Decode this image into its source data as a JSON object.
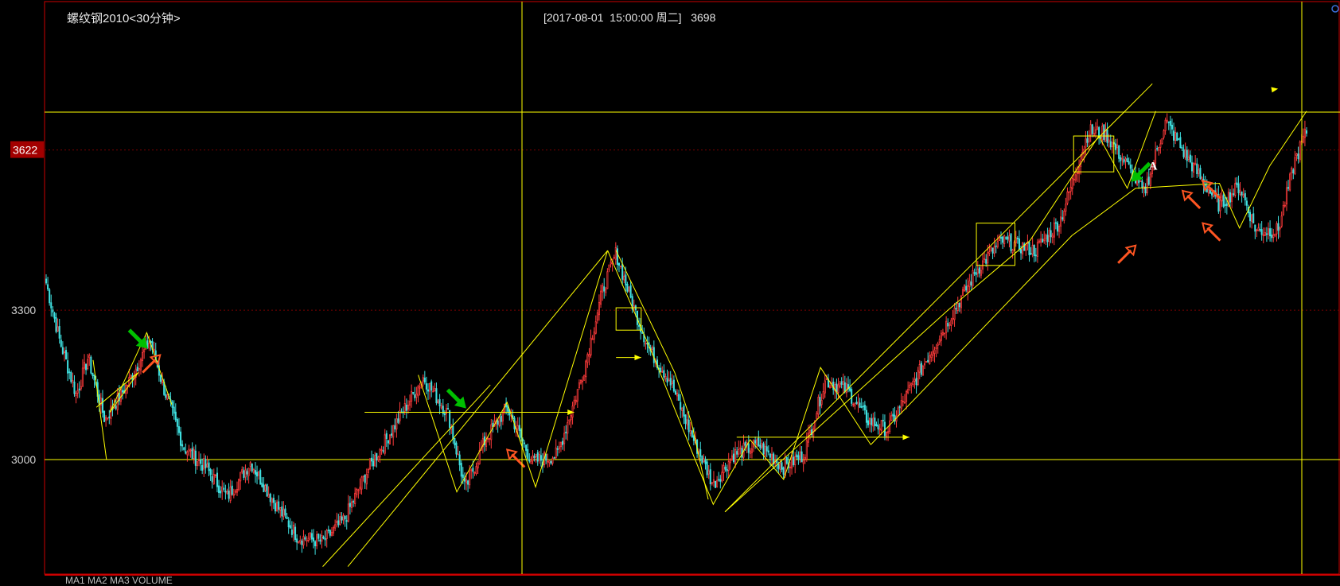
{
  "header": {
    "title": "螺纹钢2010<30分钟>",
    "cursor_time": "[2017-08-01  15:00:00 周二]",
    "cursor_value": "3698"
  },
  "price_axis": {
    "labels": [
      "3300",
      "3000"
    ],
    "highlight_label": "3622"
  },
  "bottom_text": "MA1 MA2 MA3 VOLUME",
  "colors": {
    "background": "#000000",
    "up": "#ff3b3b",
    "down": "#3fe0e0",
    "trend_line": "#ffff00",
    "buy_arrow": "#00c000",
    "sell_arrow": "#ff5522",
    "axis": "#cc0000",
    "label_bg": "#a30000"
  },
  "chart_data": {
    "type": "candlestick",
    "title": "螺纹钢2010<30分钟>",
    "ylim": [
      2770,
      3920
    ],
    "y_ticks": [
      3000,
      3300
    ],
    "guide_levels": [
      3000,
      3698
    ],
    "dashed_levels": [
      3300,
      3622
    ],
    "highlight_value": 3622,
    "cursor_times": [
      "2017-08-01 15:00:00"
    ],
    "anchors": [
      [
        0,
        3355
      ],
      [
        8,
        3240
      ],
      [
        18,
        3130
      ],
      [
        25,
        3205
      ],
      [
        35,
        3080
      ],
      [
        50,
        3160
      ],
      [
        62,
        3240
      ],
      [
        70,
        3145
      ],
      [
        82,
        3025
      ],
      [
        95,
        2985
      ],
      [
        108,
        2925
      ],
      [
        122,
        2995
      ],
      [
        135,
        2920
      ],
      [
        150,
        2845
      ],
      [
        165,
        2835
      ],
      [
        178,
        2880
      ],
      [
        192,
        2980
      ],
      [
        210,
        3080
      ],
      [
        225,
        3165
      ],
      [
        240,
        3090
      ],
      [
        250,
        2940
      ],
      [
        262,
        3040
      ],
      [
        275,
        3105
      ],
      [
        290,
        2995
      ],
      [
        305,
        3010
      ],
      [
        320,
        3170
      ],
      [
        332,
        3340
      ],
      [
        340,
        3415
      ],
      [
        350,
        3310
      ],
      [
        360,
        3220
      ],
      [
        372,
        3160
      ],
      [
        385,
        3050
      ],
      [
        398,
        2950
      ],
      [
        410,
        3010
      ],
      [
        425,
        3030
      ],
      [
        440,
        2985
      ],
      [
        452,
        3010
      ],
      [
        465,
        3160
      ],
      [
        478,
        3140
      ],
      [
        490,
        3080
      ],
      [
        502,
        3060
      ],
      [
        512,
        3120
      ],
      [
        525,
        3200
      ],
      [
        540,
        3290
      ],
      [
        555,
        3380
      ],
      [
        570,
        3440
      ],
      [
        590,
        3420
      ],
      [
        605,
        3480
      ],
      [
        622,
        3660
      ],
      [
        632,
        3655
      ],
      [
        645,
        3590
      ],
      [
        655,
        3535
      ],
      [
        668,
        3680
      ],
      [
        680,
        3610
      ],
      [
        700,
        3510
      ],
      [
        712,
        3550
      ],
      [
        722,
        3460
      ],
      [
        735,
        3460
      ],
      [
        745,
        3600
      ],
      [
        752,
        3660
      ]
    ],
    "candle_count": 760,
    "overlays": {
      "trend_lines": [
        [
          [
            30,
            3105
          ],
          [
            55,
            3175
          ],
          [
            38,
            3095
          ],
          [
            60,
            3255
          ],
          [
            75,
            3110
          ]
        ],
        [
          [
            36,
            3000
          ],
          [
            28,
            3200
          ]
        ],
        [
          [
            165,
            2785
          ],
          [
            265,
            3150
          ]
        ],
        [
          [
            180,
            2785
          ],
          [
            335,
            3420
          ]
        ],
        [
          [
            335,
            3420
          ],
          [
            362,
            3210
          ],
          [
            398,
            2910
          ],
          [
            420,
            3040
          ],
          [
            440,
            2960
          ],
          [
            462,
            3185
          ],
          [
            492,
            3030
          ]
        ],
        [
          [
            340,
            3420
          ],
          [
            375,
            3175
          ],
          [
            385,
            3075
          ],
          [
            395,
            2920
          ]
        ],
        [
          [
            405,
            2895
          ],
          [
            538,
            3300
          ],
          [
            587,
            3440
          ],
          [
            628,
            3650
          ],
          [
            645,
            3545
          ],
          [
            662,
            3700
          ]
        ],
        [
          [
            405,
            2895
          ],
          [
            660,
            3755
          ]
        ],
        [
          [
            492,
            3030
          ],
          [
            612,
            3450
          ],
          [
            650,
            3545
          ],
          [
            700,
            3555
          ],
          [
            712,
            3465
          ],
          [
            730,
            3590
          ],
          [
            752,
            3700
          ]
        ]
      ],
      "zigzags": [
        [
          [
            222,
            3170
          ],
          [
            245,
            2935
          ],
          [
            275,
            3115
          ],
          [
            292,
            2945
          ],
          [
            335,
            3420
          ]
        ]
      ],
      "h_arrows": [
        {
          "x1": 190,
          "x2": 315,
          "y": 3095
        },
        {
          "x1": 340,
          "x2": 355,
          "y": 3205
        },
        {
          "x1": 412,
          "x2": 515,
          "y": 3045
        }
      ],
      "v_arrows": [
        {
          "x1": 700,
          "y1": 3725,
          "x2": 735,
          "y2": 3745
        }
      ],
      "boxes": [
        {
          "x1": 340,
          "x2": 355,
          "y1": 3260,
          "y2": 3305
        },
        {
          "x1": 555,
          "x2": 578,
          "y1": 3390,
          "y2": 3475
        },
        {
          "x1": 613,
          "x2": 637,
          "y1": 3578,
          "y2": 3650
        }
      ],
      "buy_arrows": [
        {
          "x": 60,
          "y": 3225,
          "dir": "down-right"
        },
        {
          "x": 250,
          "y": 3105,
          "dir": "down-right"
        },
        {
          "x": 648,
          "y": 3560,
          "dir": "down-left"
        }
      ],
      "sell_arrows": [
        {
          "x": 68,
          "y": 3210,
          "dir": "up-right"
        },
        {
          "x": 275,
          "y": 3020,
          "dir": "up-left"
        },
        {
          "x": 650,
          "y": 3430,
          "dir": "up-right"
        },
        {
          "x": 678,
          "y": 3540,
          "dir": "up-left"
        },
        {
          "x": 690,
          "y": 3475,
          "dir": "up-left"
        },
        {
          "x": 690,
          "y": 3560,
          "dir": "up-left"
        }
      ],
      "label_A": {
        "text": "A",
        "x": 655,
        "y": 3560
      }
    }
  }
}
